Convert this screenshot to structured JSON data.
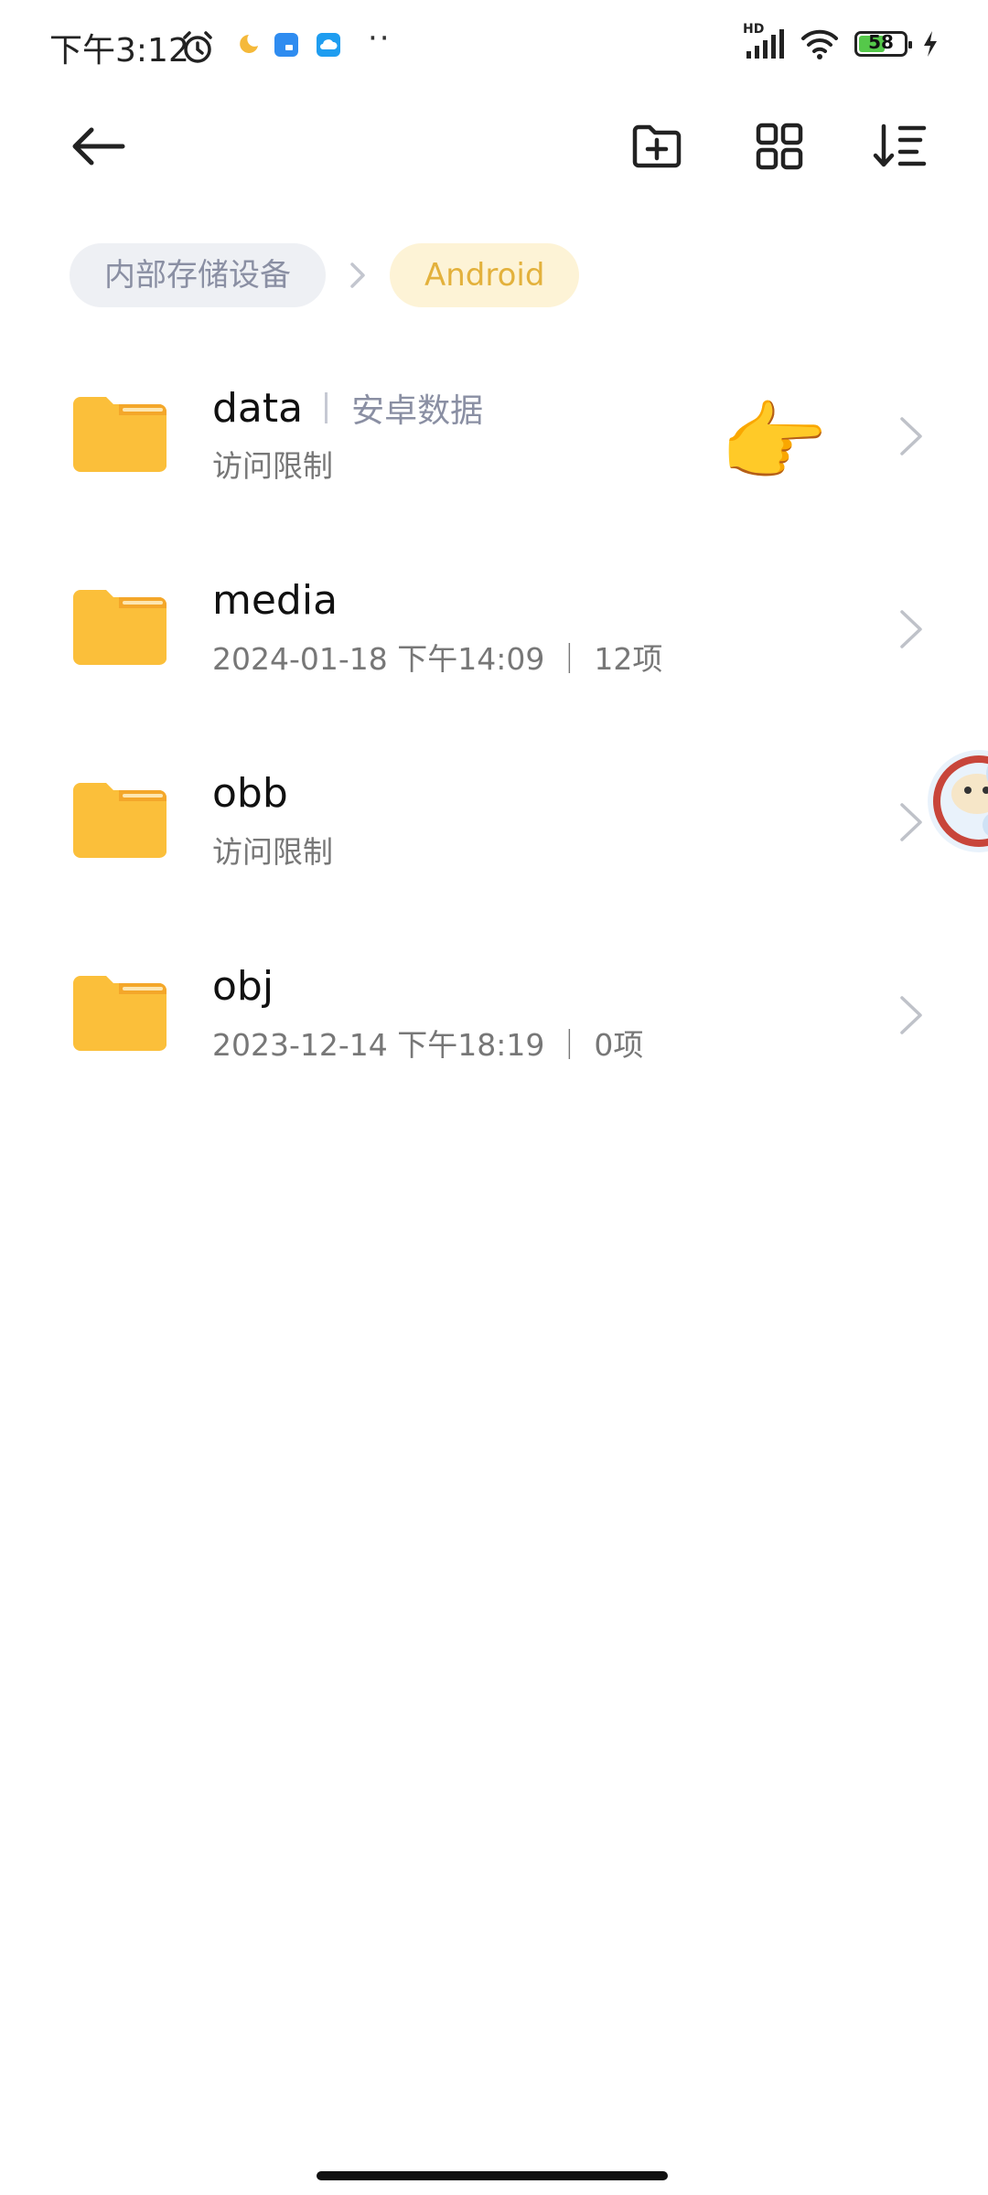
{
  "status_bar": {
    "time": "下午3:12",
    "dots": "··",
    "network_badge": "HD",
    "battery": "58",
    "battery_level": 0.58
  },
  "breadcrumb": {
    "root": "内部存储设备",
    "current": "Android"
  },
  "files": [
    {
      "name": "data",
      "tag": "安卓数据",
      "subtitle": "访问限制"
    },
    {
      "name": "media",
      "subtitle": "2024-01-18 下午14:09 ｜ 12项"
    },
    {
      "name": "obb",
      "subtitle": "访问限制"
    },
    {
      "name": "obj",
      "subtitle": "2023-12-14 下午18:19 ｜ 0项"
    }
  ],
  "colors": {
    "folder": "#fbbf3a",
    "folder_tab": "#f4a72a",
    "accent_current": "#e3b13c",
    "crumb_bg": "#eef0f4"
  }
}
